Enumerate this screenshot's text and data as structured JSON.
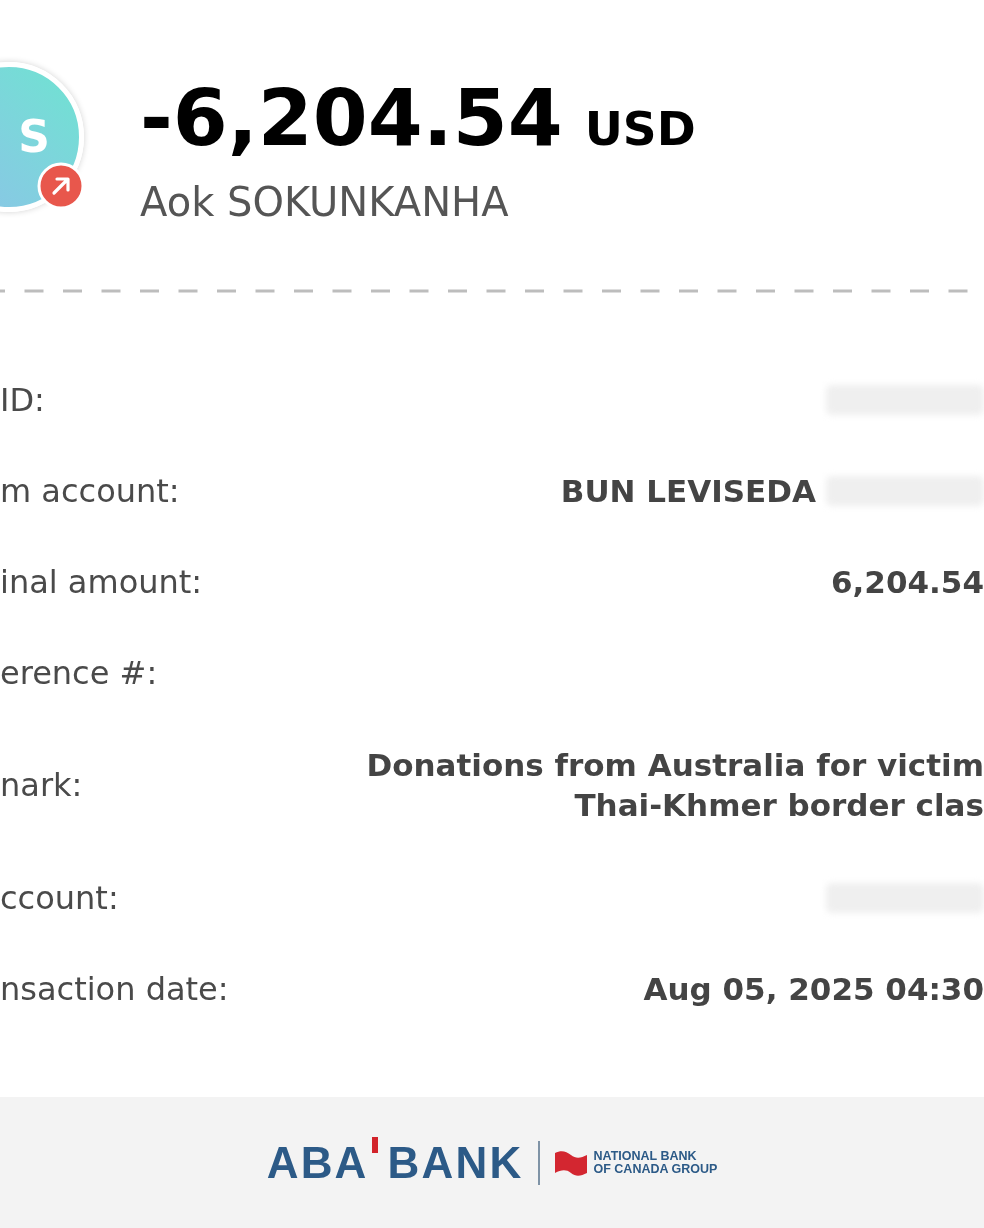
{
  "header": {
    "avatar": {
      "initials": "S",
      "outgoing": true
    },
    "amount": "-6,204.54",
    "currency": "USD",
    "name": "Aok SOKUNKANHA"
  },
  "details": [
    {
      "label": "ID:",
      "redacted": true
    },
    {
      "label": "m account:",
      "value": "BUN LEVISEDA",
      "redacted": true
    },
    {
      "label": "inal amount:",
      "value": "6,204.54",
      "redacted": false
    },
    {
      "label": "erence #:",
      "redacted": false
    },
    {
      "label": "nark:",
      "value_lines": [
        "Donations from Australia for victim",
        "Thai-Khmer border clas"
      ],
      "redacted": false
    },
    {
      "label": "ccount:",
      "redacted": true
    },
    {
      "label": "nsaction date:",
      "value": "Aug 05, 2025 04:30",
      "redacted": false
    }
  ],
  "footer": {
    "logo_words": [
      "ABA",
      "BANK"
    ],
    "group_lines": [
      "NATIONAL BANK",
      "OF CANADA GROUP"
    ]
  }
}
